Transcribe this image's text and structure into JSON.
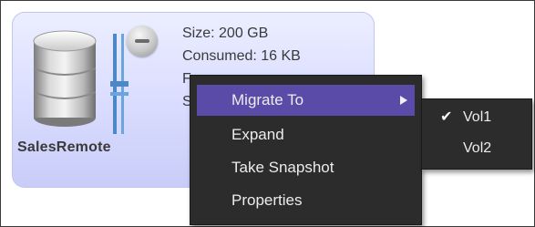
{
  "volume": {
    "name": "SalesRemote",
    "size_text": "Size: 200 GB",
    "consumed_text": "Consumed: 16 KB",
    "hidden_line_1_prefix": "F",
    "hidden_line_2_prefix": "S"
  },
  "icons": {
    "database": "database-icon",
    "connector": "storage-connector-icon",
    "remove": "minus-circle-icon",
    "submenu_arrow": "triangle-right-icon",
    "check": "checkmark-icon"
  },
  "context_menu": {
    "items": [
      {
        "label": "Migrate To",
        "highlighted": true,
        "has_submenu": true
      },
      {
        "label": "Expand"
      },
      {
        "label": "Take Snapshot"
      },
      {
        "label": "Properties"
      }
    ]
  },
  "submenu": {
    "items": [
      {
        "label": "Vol1",
        "checked": true,
        "check_glyph": "✔"
      },
      {
        "label": "Vol2",
        "checked": false
      }
    ]
  },
  "colors": {
    "menu_background": "#2c2c2c",
    "menu_highlight": "#5b4ba8",
    "card_background": "#dcdfff",
    "text_dark": "#3a3a3a"
  }
}
